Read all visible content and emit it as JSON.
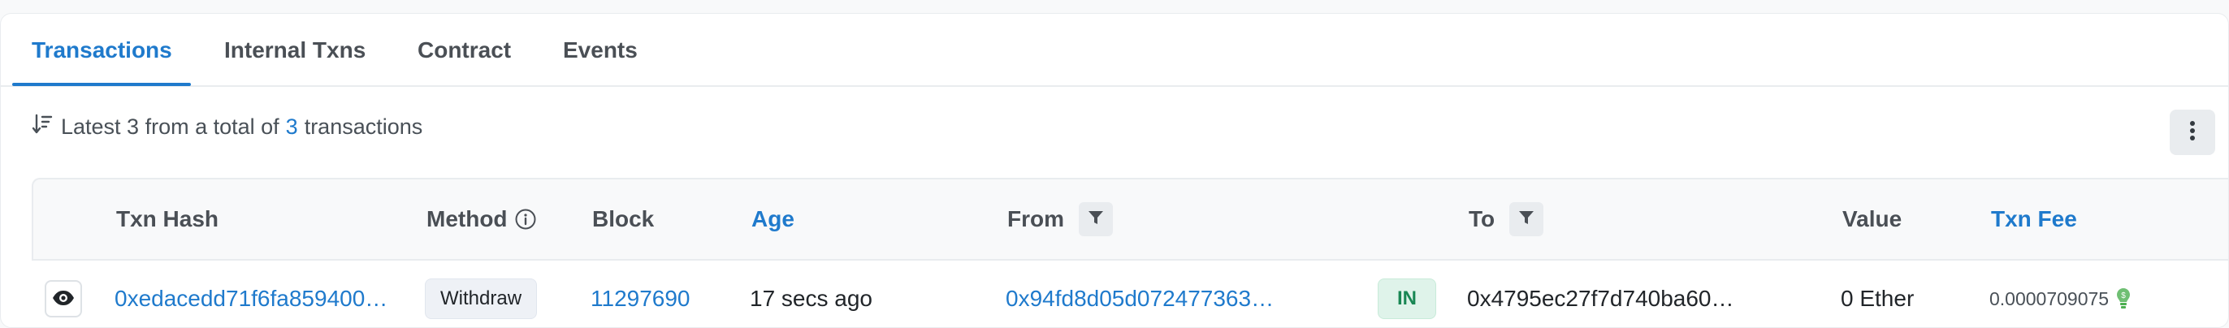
{
  "tabs": [
    {
      "label": "Transactions"
    },
    {
      "label": "Internal Txns"
    },
    {
      "label": "Contract"
    },
    {
      "label": "Events"
    }
  ],
  "summary": {
    "prefix": "Latest 3 from a total of",
    "count": "3",
    "suffix": "transactions"
  },
  "table": {
    "headers": {
      "txn_hash": "Txn Hash",
      "method": "Method",
      "block": "Block",
      "age": "Age",
      "from": "From",
      "to": "To",
      "value": "Value",
      "txn_fee": "Txn Fee"
    },
    "rows": [
      {
        "txn_hash": "0xedacedd71f6fa859400…",
        "method": "Withdraw",
        "block": "11297690",
        "age": "17 secs ago",
        "from": "0x94fd8d05d072477363…",
        "direction": "IN",
        "to": "0x4795ec27f7d740ba60…",
        "value": "0 Ether",
        "txn_fee": "0.0000709075"
      }
    ]
  },
  "colors": {
    "accent": "#1f7acc",
    "in_badge_bg": "#dff3ea",
    "in_badge_text": "#198754"
  },
  "icons": [
    "sort-icon",
    "more-vertical-icon",
    "info-icon",
    "filter-icon",
    "eye-icon",
    "gas-icon"
  ]
}
